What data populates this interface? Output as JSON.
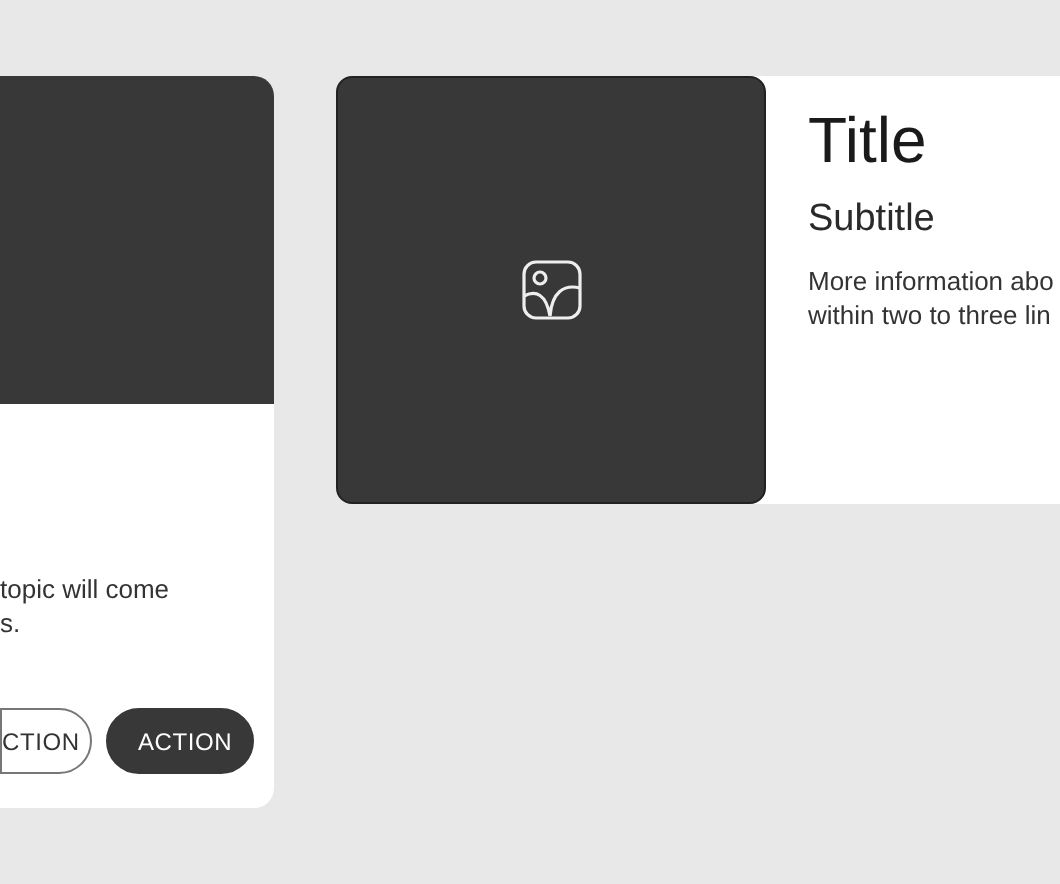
{
  "cards": [
    {
      "kind": "vertical",
      "body_lines": [
        "topic will come",
        "s."
      ],
      "buttons": [
        {
          "label": "CTION",
          "kind": "outlined"
        },
        {
          "label": "ACTION",
          "kind": "filled"
        }
      ]
    },
    {
      "kind": "horizontal",
      "title": "Title",
      "subtitle": "Subtitle",
      "body_lines": [
        "More information abo",
        "within two to three lin"
      ]
    }
  ]
}
